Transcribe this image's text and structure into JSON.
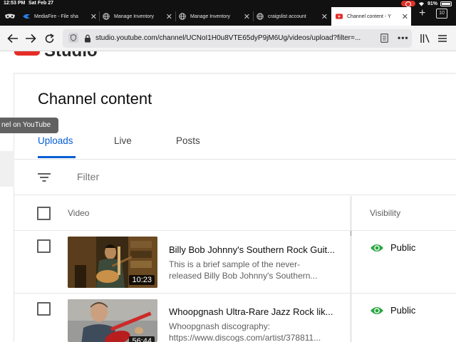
{
  "status_bar": {
    "time": "12:53 PM",
    "date": "Sat Feb 27",
    "battery": "91%"
  },
  "browser": {
    "tabs": [
      {
        "label": "MediaFire - File sha",
        "icon": "mediafire-icon"
      },
      {
        "label": "Manage Inventory",
        "icon": "globe-icon"
      },
      {
        "label": "Manage Inventory",
        "icon": "globe-icon"
      },
      {
        "label": "craigslist account",
        "icon": "globe-icon"
      },
      {
        "label": "Channel content - Y",
        "icon": "youtube-icon",
        "active": true
      }
    ],
    "tab_count": "10",
    "url": "studio.youtube.com/channel/UCNoI1H0u8VTE65dyP9jM6Ug/videos/upload?filter=..."
  },
  "header": {
    "studio_label": "Studio"
  },
  "tooltip": "nel on YouTube",
  "page": {
    "title": "Channel content",
    "tabs": [
      "Uploads",
      "Live",
      "Posts"
    ],
    "active_tab": "Uploads",
    "filter_placeholder": "Filter",
    "columns": {
      "video": "Video",
      "visibility": "Visibility"
    },
    "videos": [
      {
        "title": "Billy Bob Johnny's Southern Rock Guit...",
        "desc_line1": "This is a brief sample of the never-",
        "desc_line2": "released Billy Bob Johnny's Southern...",
        "duration": "10:23",
        "visibility": "Public"
      },
      {
        "title": "Whoopgnash Ultra-Rare Jazz Rock lik...",
        "desc_line1": "Whoopgnash discography:",
        "desc_line2": "https://www.discogs.com/artist/378811...",
        "duration": "56:44",
        "visibility": "Public"
      }
    ]
  },
  "colors": {
    "accent_blue": "#065fd4",
    "public_green": "#2ba640",
    "youtube_red": "#e52d27"
  }
}
